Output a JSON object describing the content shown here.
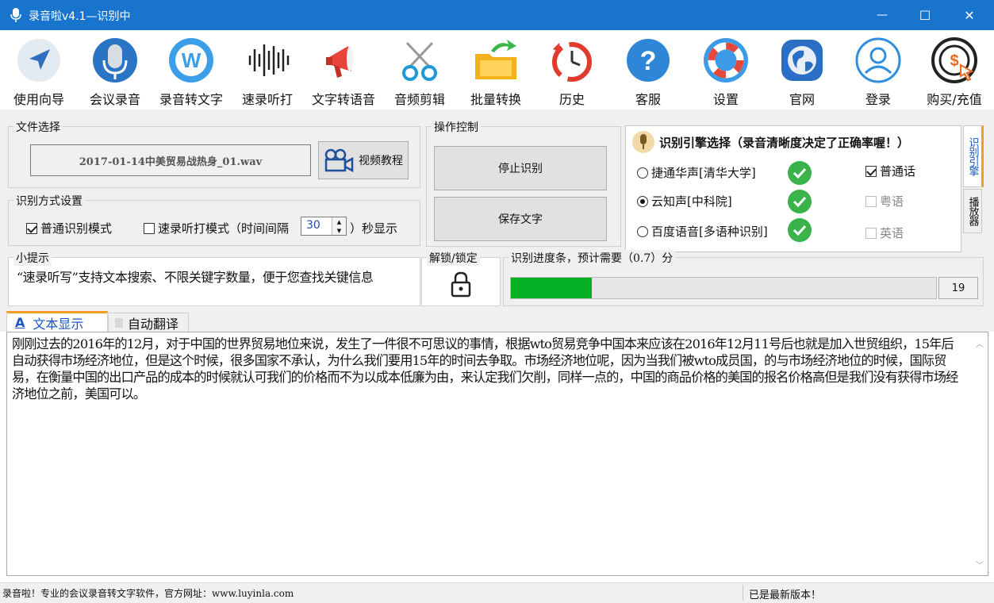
{
  "window": {
    "title": "录音啦v4.1—识别中",
    "accent": "#1874cd",
    "controls": {
      "minimize": "—",
      "maximize": "☐",
      "close": "✕"
    }
  },
  "toolbar": {
    "items": [
      {
        "label": "使用向导",
        "icon": "compass-arrow-icon"
      },
      {
        "label": "会议录音",
        "icon": "microphone-icon"
      },
      {
        "label": "录音转文字",
        "icon": "w-letter-icon"
      },
      {
        "label": "速录听打",
        "icon": "sound-wave-icon"
      },
      {
        "label": "文字转语音",
        "icon": "megaphone-icon"
      },
      {
        "label": "音频剪辑",
        "icon": "scissors-icon"
      },
      {
        "label": "批量转换",
        "icon": "folder-arrow-icon"
      },
      {
        "label": "历史",
        "icon": "history-clock-icon"
      },
      {
        "label": "客服",
        "icon": "question-icon"
      },
      {
        "label": "设置",
        "icon": "lifebuoy-icon"
      },
      {
        "label": "官网",
        "icon": "globe-icon"
      },
      {
        "label": "登录",
        "icon": "user-icon"
      },
      {
        "label": "购买/充值",
        "icon": "coin-cursor-icon"
      }
    ]
  },
  "file_select": {
    "label": "文件选择",
    "filename": "2017-01-14中美贸易战热身_01.wav",
    "video_button": "视频教程"
  },
  "recog_mode": {
    "label": "识别方式设置",
    "normal_mode": "普通识别模式",
    "normal_checked": true,
    "fast_mode": "速录听打模式（时间间隔",
    "fast_checked": false,
    "interval": "30",
    "suffix": "）秒显示"
  },
  "op_control": {
    "label": "操作控制",
    "stop": "停止识别",
    "save": "保存文字"
  },
  "engine": {
    "title": "识别引擎选择（录音清晰度决定了正确率喔！）",
    "options": [
      {
        "name": "捷通华声[清华大学]",
        "selected": false
      },
      {
        "name": "云知声[中科院]",
        "selected": true
      },
      {
        "name": "百度语音[多语种识别]",
        "selected": false
      }
    ],
    "languages": [
      {
        "name": "普通话",
        "checked": true,
        "enabled": true
      },
      {
        "name": "粤语",
        "checked": false,
        "enabled": false
      },
      {
        "name": "英语",
        "checked": false,
        "enabled": false
      }
    ],
    "side_tabs": [
      "识别引擎",
      "播放器"
    ]
  },
  "tips": {
    "label": "小提示",
    "text": "“速录听写”支持文本搜索、不限关键字数量，便于您查找关键信息"
  },
  "lock": {
    "label": "解锁/锁定"
  },
  "progress": {
    "label": "识别进度条，预计需要（0.7）分",
    "value": 19,
    "display": "19",
    "fill_color": "#06b025"
  },
  "tabs": [
    {
      "label": "文本显示",
      "active": true
    },
    {
      "label": "自动翻译",
      "active": false
    }
  ],
  "content": {
    "text": "刚刚过去的2016年的12月，对于中国的世界贸易地位来说，发生了一件很不可思议的事情，根据wto贸易竞争中国本来应该在2016年12月11号后也就是加入世贸组织，15年后自动获得市场经济地位，但是这个时候，很多国家不承认，为什么我们要用15年的时间去争取。市场经济地位呢，因为当我们被wto成员国，的与市场经济地位的时候，国际贸易，在衡量中国的出口产品的成本的时候就认可我们的价格而不为以成本低廉为由，来认定我们欠削，同样一点的，中国的商品价格的美国的报名价格高但是我们没有获得市场经济地位之前，美国可以。"
  },
  "status": {
    "left": "录音啦！专业的会议录音转文字软件，官方网址：www.luyinla.com",
    "right": "已是最新版本！"
  }
}
